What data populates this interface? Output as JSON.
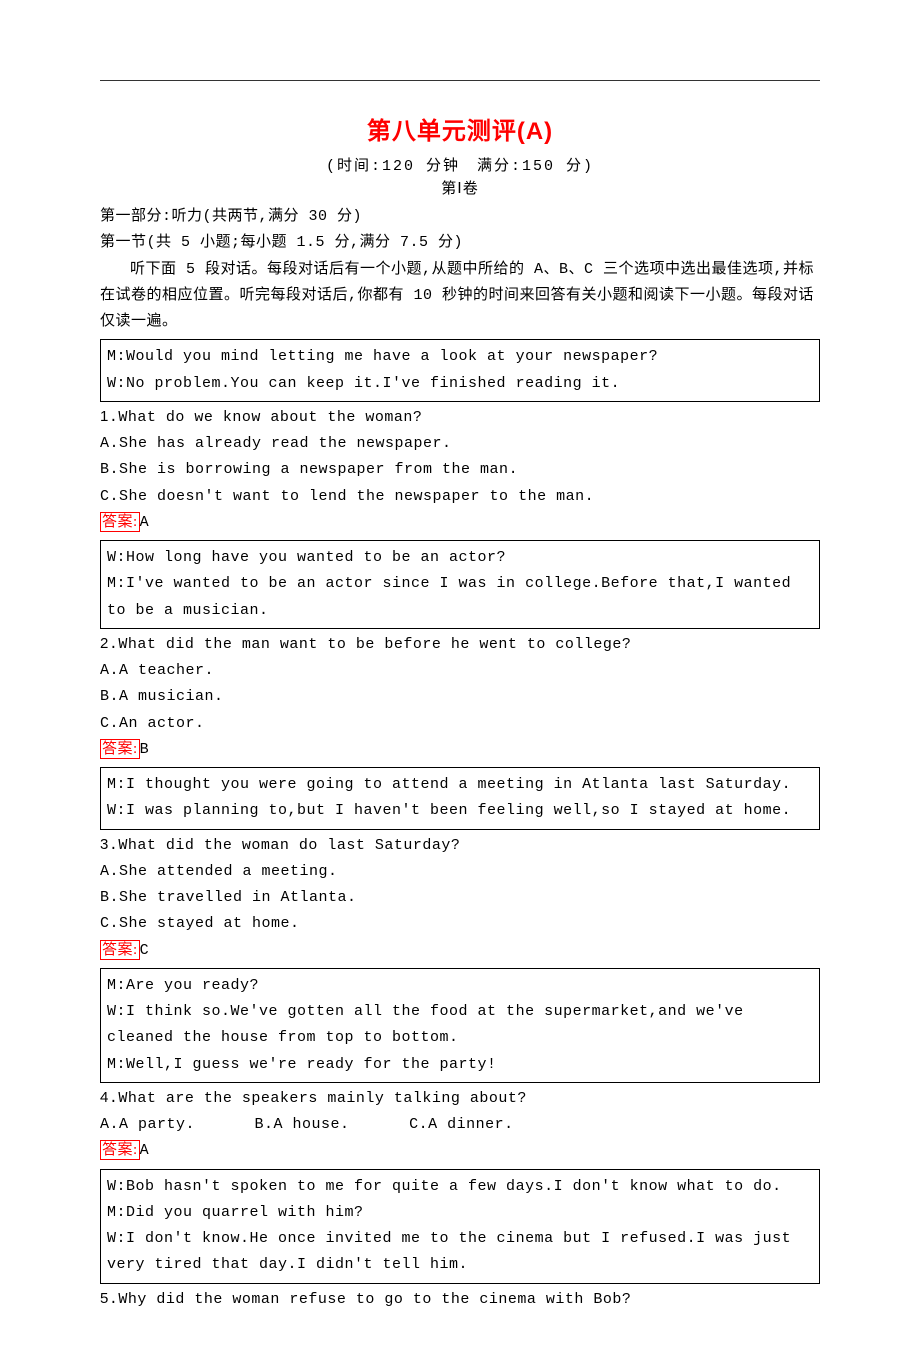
{
  "title": "第八单元测评(A)",
  "subtitle": "(时间:120 分钟　满分:150 分)",
  "paper_part": "第Ⅰ卷",
  "part1_header": "第一部分:听力(共两节,满分 30 分)",
  "section1_header": "第一节(共 5 小题;每小题 1.5 分,满分 7.5 分)",
  "instructions": "听下面 5 段对话。每段对话后有一个小题,从题中所给的 A、B、C 三个选项中选出最佳选项,并标在试卷的相应位置。听完每段对话后,你都有 10 秒钟的时间来回答有关小题和阅读下一小题。每段对话仅读一遍。",
  "d1_l1": "M:Would you mind letting me have a look at your newspaper?",
  "d1_l2": "W:No problem.You can keep it.I've finished reading it.",
  "q1_num": "1",
  "q1_text": ".What do we know about the woman?",
  "q1_a": "A.She has already read the newspaper.",
  "q1_b": "B.She is borrowing a newspaper from the man.",
  "q1_c": "C.She doesn't want to lend the newspaper to the man.",
  "ans_label": "答案:",
  "q1_ans": "A",
  "d2_l1": "W:How long have you wanted to be an actor?",
  "d2_l2": "M:I've wanted to be an actor since I was in college.Before that,I wanted to be a musician.",
  "q2_num": "2",
  "q2_text": ".What did the man want to be before he went to college?",
  "q2_a": "A.A teacher.",
  "q2_b": "B.A musician.",
  "q2_c": "C.An actor.",
  "q2_ans": "B",
  "d3_l1": "M:I thought you were going to attend a meeting in Atlanta last Saturday.",
  "d3_l2": "W:I was planning to,but I haven't been feeling well,so I stayed at home.",
  "q3_num": "3",
  "q3_text": ".What did the woman do last Saturday?",
  "q3_a": "A.She attended a meeting.",
  "q3_b": "B.She travelled in Atlanta.",
  "q3_c": "C.She stayed at home.",
  "q3_ans": "C",
  "d4_l1": "M:Are you ready?",
  "d4_l2": "W:I think so.We've gotten all the food at the supermarket,and we've cleaned the house from top to bottom.",
  "d4_l3": "M:Well,I guess we're ready for the party!",
  "q4_num": "4",
  "q4_text": ".What are the speakers mainly talking about?",
  "q4_a": "A.A party.",
  "q4_b": "B.A house.",
  "q4_c": "C.A dinner.",
  "q4_ans": "A",
  "d5_l1": "W:Bob hasn't spoken to me for quite a few days.I don't know what to do.",
  "d5_l2": "M:Did you quarrel with him?",
  "d5_l3": "W:I don't know.He once invited me to the cinema but I refused.I was just very tired that day.I didn't tell him.",
  "q5_num": "5",
  "q5_text": ".Why did the woman refuse to go to the cinema with Bob?"
}
